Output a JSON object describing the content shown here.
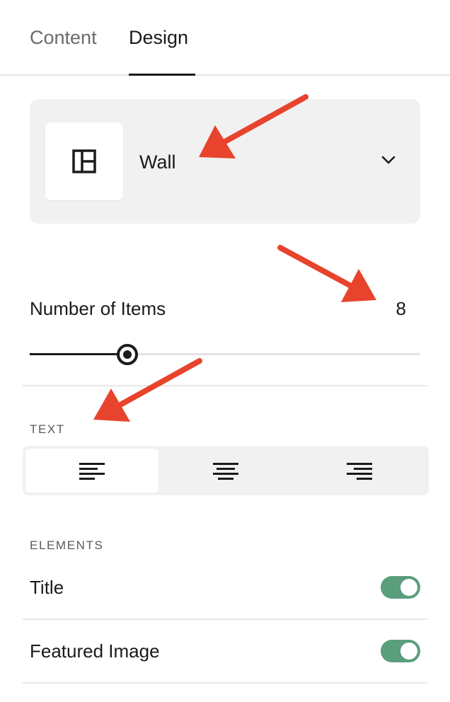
{
  "tabs": {
    "content_label": "Content",
    "design_label": "Design",
    "active": "Design"
  },
  "layout": {
    "name": "Wall",
    "thumb_icon": "layout-wall-icon",
    "dropdown_icon": "chevron-down-icon"
  },
  "items": {
    "label": "Number of Items",
    "value": "8",
    "slider_fraction": 0.25
  },
  "text_section": {
    "label": "TEXT",
    "align_options": [
      "align-left",
      "align-center",
      "align-right"
    ],
    "selected": "align-left"
  },
  "elements_section": {
    "label": "ELEMENTS",
    "rows": [
      {
        "label": "Title",
        "enabled": true
      },
      {
        "label": "Featured Image",
        "enabled": true
      }
    ]
  },
  "colors": {
    "toggle_on": "#5a9e7c",
    "annotation_arrow": "#e8432d",
    "card_bg": "#f1f1f1"
  }
}
